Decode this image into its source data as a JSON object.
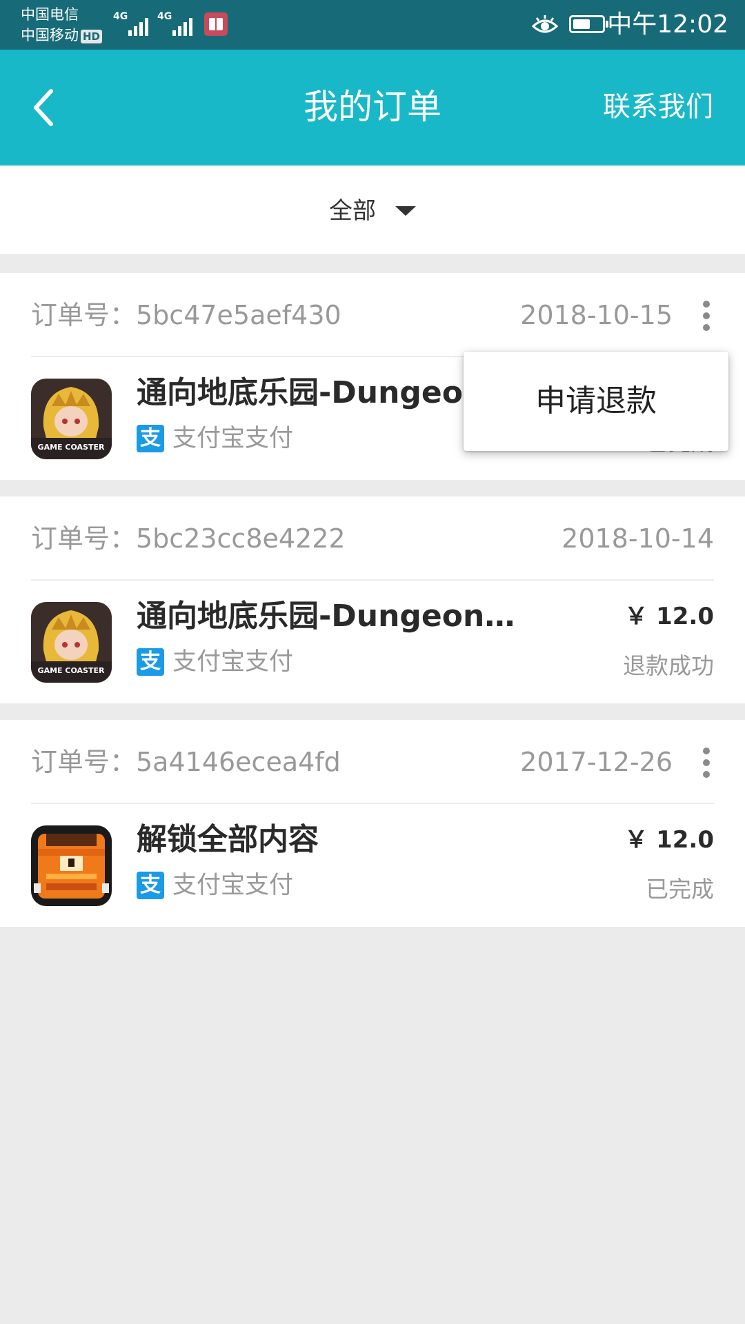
{
  "status_bar": {
    "carrier_1": "中国电信",
    "carrier_2": "中国移动",
    "hd_badge": "HD",
    "network_1": "4G",
    "network_2": "4G",
    "time": "中午12:02"
  },
  "app_bar": {
    "title": "我的订单",
    "contact_label": "联系我们",
    "back_icon": "chevron-left-icon"
  },
  "filter": {
    "selected": "全部",
    "icon": "caret-down-icon"
  },
  "orders": [
    {
      "order_label": "订单号：5bc47e5aef430",
      "date": "2018-10-15",
      "has_menu": true,
      "product": "通向地底乐园-Dungeon…",
      "payment": "支付宝支付",
      "price": "",
      "status": "已完成",
      "icon": "game-coaster-girl-icon"
    },
    {
      "order_label": "订单号：5bc23cc8e4222",
      "date": "2018-10-14",
      "has_menu": false,
      "product": "通向地底乐园-Dungeon…",
      "payment": "支付宝支付",
      "price": "￥ 12.0",
      "status": "退款成功",
      "icon": "game-coaster-girl-icon"
    },
    {
      "order_label": "订单号：5a4146ecea4fd",
      "date": "2017-12-26",
      "has_menu": true,
      "product": "解锁全部内容",
      "payment": "支付宝支付",
      "price": "￥ 12.0",
      "status": "已完成",
      "icon": "orange-monster-icon"
    }
  ],
  "popup_menu": {
    "item": "申请退款"
  },
  "colors": {
    "status_bar": "#176b78",
    "app_bar": "#18b8c8",
    "alipay": "#1a9be8",
    "page_bg": "#ebebeb"
  }
}
